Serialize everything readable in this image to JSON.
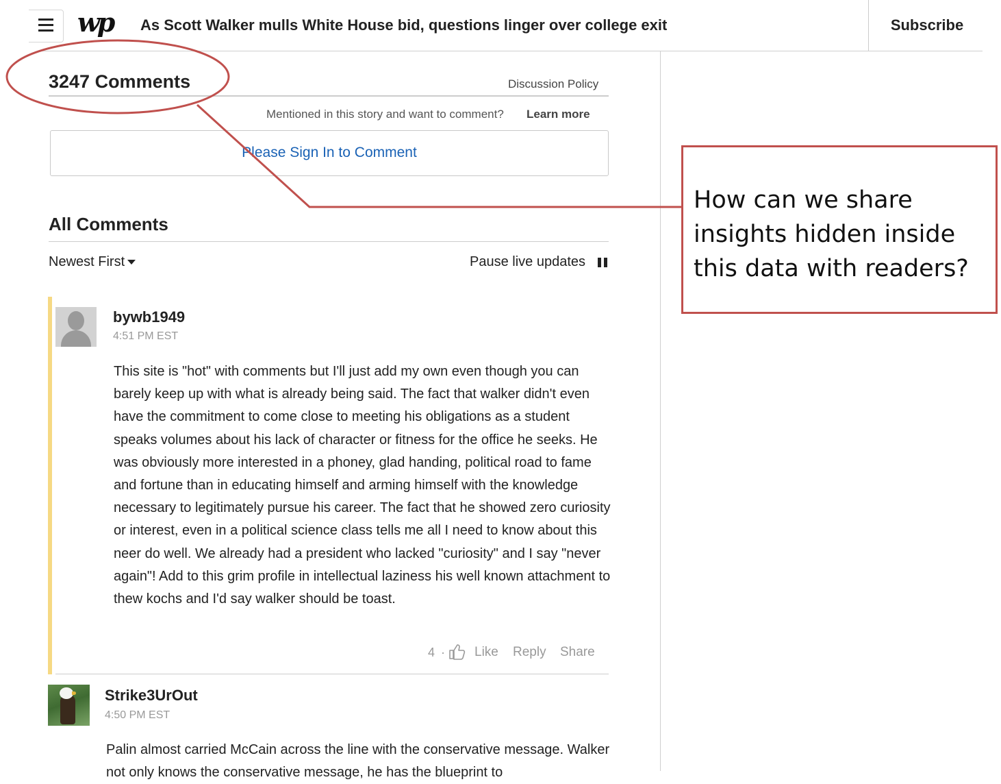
{
  "header": {
    "logo": "wp",
    "headline": "As Scott Walker mulls White House bid, questions linger over college exit",
    "subscribe_label": "Subscribe"
  },
  "comments_section": {
    "count_label": "3247 Comments",
    "discussion_policy": "Discussion Policy",
    "mention_prompt": "Mentioned in this story and want to comment?",
    "learn_more": "Learn more",
    "sign_in_label": "Please Sign In to Comment",
    "all_comments_heading": "All Comments",
    "sort_label": "Newest First",
    "pause_label": "Pause live updates"
  },
  "comments": [
    {
      "username": "bywb1949",
      "time": "4:51 PM EST",
      "text": "This site is \"hot\" with comments but I'll just add my own even though you can barely keep up with what is already being said. The fact that walker didn't even have the commitment to come close to meeting his obligations as a student speaks volumes about his lack of character or fitness for the office he seeks. He was obviously more interested in a phoney, glad handing, political road to fame and fortune than in educating himself and arming himself with the knowledge necessary to legitimately pursue his career. The fact that he showed zero curiosity or interest, even in a political science class tells me all I need to know about this neer do well. We already had a president who lacked \"curiosity\" and I say \"never again\"! Add to this grim profile in intellectual laziness his well known attachment to thew kochs and I'd say walker should be toast.",
      "likes": "4",
      "separator": "·",
      "like_label": "Like",
      "reply_label": "Reply",
      "share_label": "Share"
    },
    {
      "username": "Strike3UrOut",
      "time": "4:50 PM EST",
      "text": "Palin almost carried McCain across the line with the conservative message. Walker not only knows the conservative message, he has the blueprint to"
    }
  ],
  "annotation": {
    "text": "How can we share insights hidden inside this data with readers?",
    "color": "#c0504d"
  },
  "colors": {
    "link_blue": "#1a62b5",
    "highlight_yellow": "#f6d984",
    "annotation_red": "#c0504d"
  }
}
